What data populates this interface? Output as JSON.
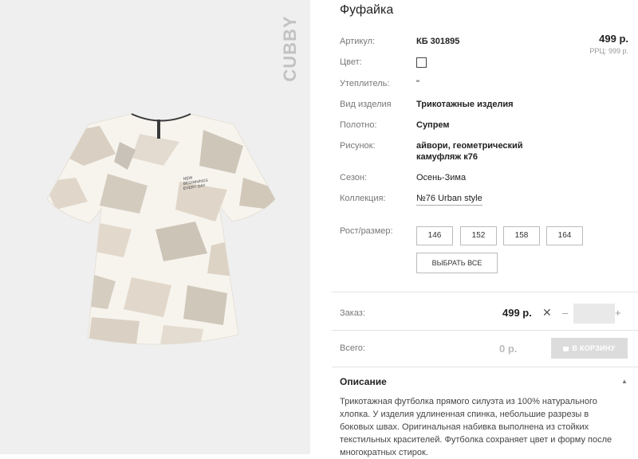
{
  "product": {
    "title": "Фуфайка",
    "brand": "CUBBY",
    "shirt_print": [
      "NEW",
      "BEGINNINGS",
      "EVERY DAY"
    ],
    "price": "499 р.",
    "rrc": "РРЦ: 999 р."
  },
  "specs": {
    "article_label": "Артикул:",
    "article_value": "КБ 301895",
    "color_label": "Цвет:",
    "insulation_label": "Утеплитель:",
    "insulation_value": "\"",
    "type_label": "Вид изделия",
    "type_value": "Трикотажные изделия",
    "fabric_label": "Полотно:",
    "fabric_value": "Супрем",
    "pattern_label": "Рисунок:",
    "pattern_line1": "айвори, геометрический",
    "pattern_line2": "камуфляж к76",
    "season_label": "Сезон:",
    "season_value": "Осень-Зима",
    "collection_label": "Коллекция:",
    "collection_value": "№76 Urban style"
  },
  "sizes": {
    "label": "Рост/размер:",
    "options": [
      "146",
      "152",
      "158",
      "164"
    ],
    "select_all": "ВЫБРАТЬ ВСЕ"
  },
  "order": {
    "label": "Заказ:",
    "price": "499 р.",
    "remove": "✕",
    "minus": "–",
    "plus": "+",
    "qty": ""
  },
  "total": {
    "label": "Всего:",
    "value": "0 р.",
    "cart_button": "В КОРЗИНУ"
  },
  "description": {
    "heading": "Описание",
    "text": "Трикотажная футболка прямого силуэта из 100% натурального хлопка. У изделия удлиненная спинка, небольшие разрезы в боковых швах. Оригинальная набивка выполнена из стойких текстильных красителей. Футболка сохраняет цвет и форму после многократных стирок."
  },
  "colors": {
    "swatch": "#ffffff",
    "cart_bg": "#dcdcdc",
    "photo_bg": "#efefef"
  }
}
